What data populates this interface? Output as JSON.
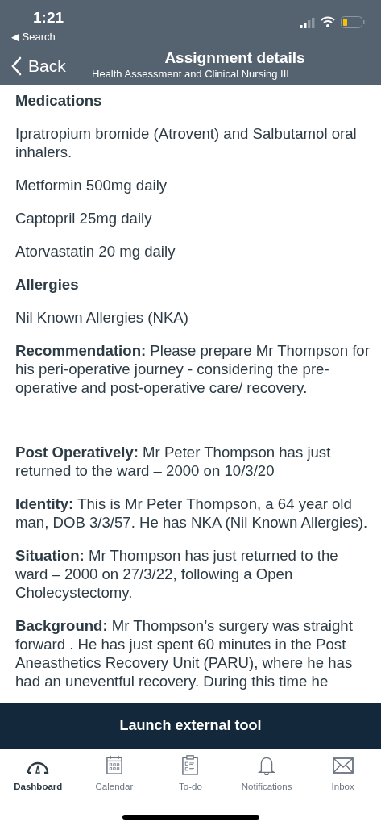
{
  "status_bar": {
    "time": "1:21",
    "back_app": "◀ Search"
  },
  "nav": {
    "back": "Back",
    "title": "Assignment details",
    "subtitle": "Health Assessment and Clinical Nursing III"
  },
  "content": [
    {
      "kind": "heading",
      "text": "Medications"
    },
    {
      "kind": "paragraph",
      "text": "Ipratropium bromide (Atrovent) and Salbutamol oral inhalers."
    },
    {
      "kind": "paragraph",
      "text": "Metformin 500mg daily"
    },
    {
      "kind": "paragraph",
      "text": "Captopril 25mg daily"
    },
    {
      "kind": "paragraph",
      "text": "Atorvastatin 20 mg daily"
    },
    {
      "kind": "heading",
      "text": "Allergies"
    },
    {
      "kind": "paragraph",
      "text": "Nil Known Allergies (NKA)"
    },
    {
      "kind": "paragraph",
      "text": "**Recommendation:** Please prepare Mr Thompson for his peri-operative journey - considering the pre-operative and post-operative care/ recovery."
    },
    {
      "kind": "spacer"
    },
    {
      "kind": "paragraph",
      "text": "**Post Operatively:** Mr Peter Thompson has just returned to the ward – 2000 on 10/3/20"
    },
    {
      "kind": "paragraph",
      "text": "**Identity:** This is Mr Peter Thompson, a 64 year old man, DOB 3/3/57. He has NKA (Nil Known Allergies)."
    },
    {
      "kind": "paragraph",
      "text": "**Situation:** Mr Thompson has just returned to the ward – 2000 on 27/3/22, following a Open Cholecystectomy."
    },
    {
      "kind": "paragraph",
      "text": "**Background:** Mr Thompson’s surgery was straight forward . He has just spent 60 minutes in the Post Aneasthetics Recovery Unit (PARU), where he has had an uneventful recovery. During this time he"
    }
  ],
  "action_button": "Launch external tool",
  "tab_bar": [
    {
      "kind": "dashboard",
      "label": "Dashboard",
      "selected": true
    },
    {
      "kind": "calendar",
      "label": "Calendar",
      "selected": false
    },
    {
      "kind": "todo",
      "label": "To-do",
      "selected": false
    },
    {
      "kind": "notifications",
      "label": "Notifications",
      "selected": false
    },
    {
      "kind": "inbox",
      "label": "Inbox",
      "selected": false
    }
  ]
}
